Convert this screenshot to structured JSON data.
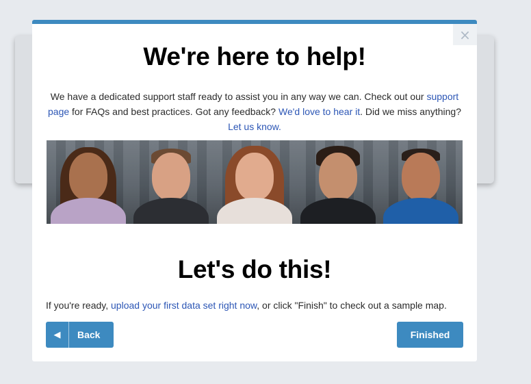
{
  "modal": {
    "close_symbol": "×",
    "title": "We're here to help!",
    "support": {
      "text1": "We have a dedicated support staff ready to assist you in any way we can. Check out our ",
      "link_support": "support page",
      "text2": " for FAQs and best practices. Got any feedback? ",
      "link_feedback": "We'd love to hear it",
      "text3": ". Did we miss anything? ",
      "link_let_us_know": "Let us know."
    },
    "photos": [
      "team-member-1",
      "team-member-2",
      "team-member-3",
      "team-member-4",
      "team-member-5"
    ],
    "subtitle": "Let's do this!",
    "ready": {
      "text1": "If you're ready, ",
      "link_upload": "upload your first data set right now",
      "text2": ", or click \"Finish\" to check out a sample map."
    },
    "buttons": {
      "back_icon": "◀",
      "back_label": "Back",
      "finished_label": "Finished"
    }
  },
  "colors": {
    "accent": "#3d8ac0",
    "link": "#2c56b5",
    "page_background": "#e7eaee"
  }
}
